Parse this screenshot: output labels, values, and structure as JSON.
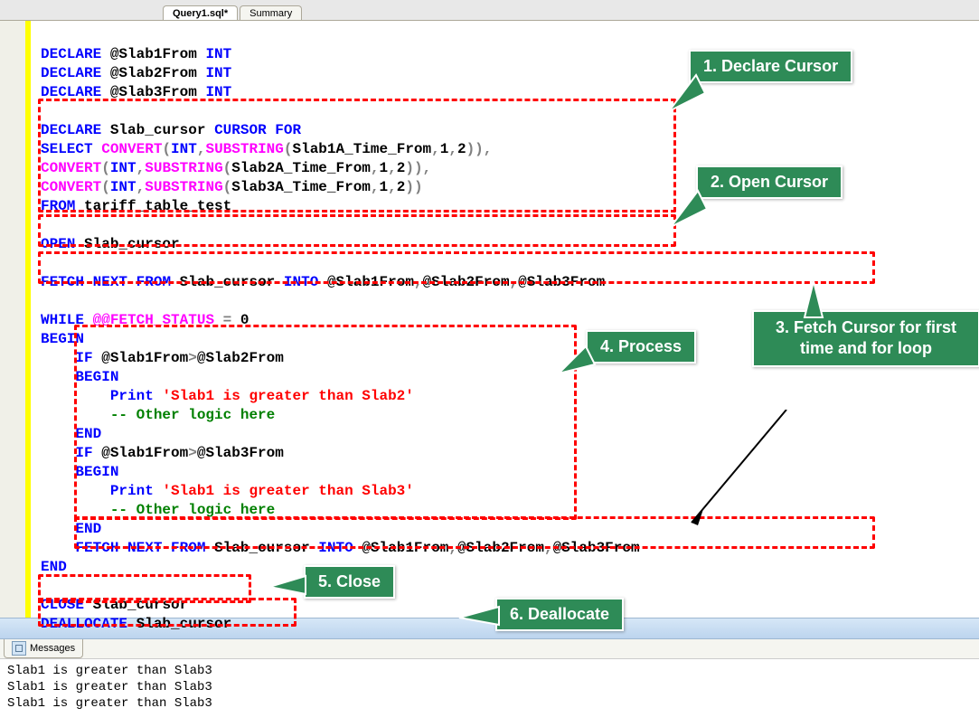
{
  "tabs": {
    "active": "Query1.sql*",
    "other": "Summary"
  },
  "code": {
    "l1": {
      "declare": "DECLARE",
      "var": "@Slab1From",
      "type": "INT"
    },
    "l2": {
      "declare": "DECLARE",
      "var": "@Slab2From",
      "type": "INT"
    },
    "l3": {
      "declare": "DECLARE",
      "var": "@Slab3From",
      "type": "INT"
    },
    "l5a": "DECLARE",
    "l5b": "Slab_cursor",
    "l5c": "CURSOR FOR",
    "l6a": "SELECT",
    "l6b": "CONVERT",
    "l6c": "INT",
    "l6d": "SUBSTRING",
    "l6e": "Slab1A_Time_From",
    "l6f": "1",
    "l6g": "2",
    "l7a": "CONVERT",
    "l7b": "INT",
    "l7c": "SUBSTRING",
    "l7d": "Slab2A_Time_From",
    "l7e": "1",
    "l7f": "2",
    "l8a": "CONVERT",
    "l8b": "INT",
    "l8c": "SUBSTRING",
    "l8d": "Slab3A_Time_From",
    "l8e": "1",
    "l8f": "2",
    "l9a": "FROM",
    "l9b": "tariff_table_test",
    "l11a": "OPEN",
    "l11b": "Slab_cursor",
    "l13a": "FETCH",
    "l13b": "NEXT",
    "l13c": "FROM",
    "l13d": "Slab_cursor",
    "l13e": "INTO",
    "l13f": "@Slab1From",
    "l13g": "@Slab2From",
    "l13h": "@Slab3From",
    "l15a": "WHILE",
    "l15b": "@@FETCH_STATUS",
    "l15c": "=",
    "l15d": "0",
    "l16": "BEGIN",
    "l17a": "IF",
    "l17b": "@Slab1From",
    "l17c": ">",
    "l17d": "@Slab2From",
    "l18": "BEGIN",
    "l19a": "Print",
    "l19b": "'Slab1 is greater than Slab2'",
    "l20": "-- Other logic here",
    "l21": "END",
    "l22a": "IF",
    "l22b": "@Slab1From",
    "l22c": ">",
    "l22d": "@Slab3From",
    "l23": "BEGIN",
    "l24a": "Print",
    "l24b": "'Slab1 is greater than Slab3'",
    "l25": "-- Other logic here",
    "l26": "END",
    "l27a": "FETCH",
    "l27b": "NEXT",
    "l27c": "FROM",
    "l27d": "Slab_cursor",
    "l27e": "INTO",
    "l27f": "@Slab1From",
    "l27g": "@Slab2From",
    "l27h": "@Slab3From",
    "l28": "END",
    "l30a": "CLOSE",
    "l30b": "Slab_cursor",
    "l31a": "DEALLOCATE",
    "l31b": "Slab_cursor"
  },
  "callouts": {
    "c1": "1. Declare Cursor",
    "c2": "2. Open Cursor",
    "c3": "3. Fetch Cursor for first time and for loop",
    "c4": "4. Process",
    "c5": "5. Close",
    "c6": "6. Deallocate"
  },
  "messages": {
    "tab": "Messages",
    "lines": [
      "Slab1 is greater than Slab3",
      "Slab1 is greater than Slab3",
      "Slab1 is greater than Slab3"
    ]
  }
}
